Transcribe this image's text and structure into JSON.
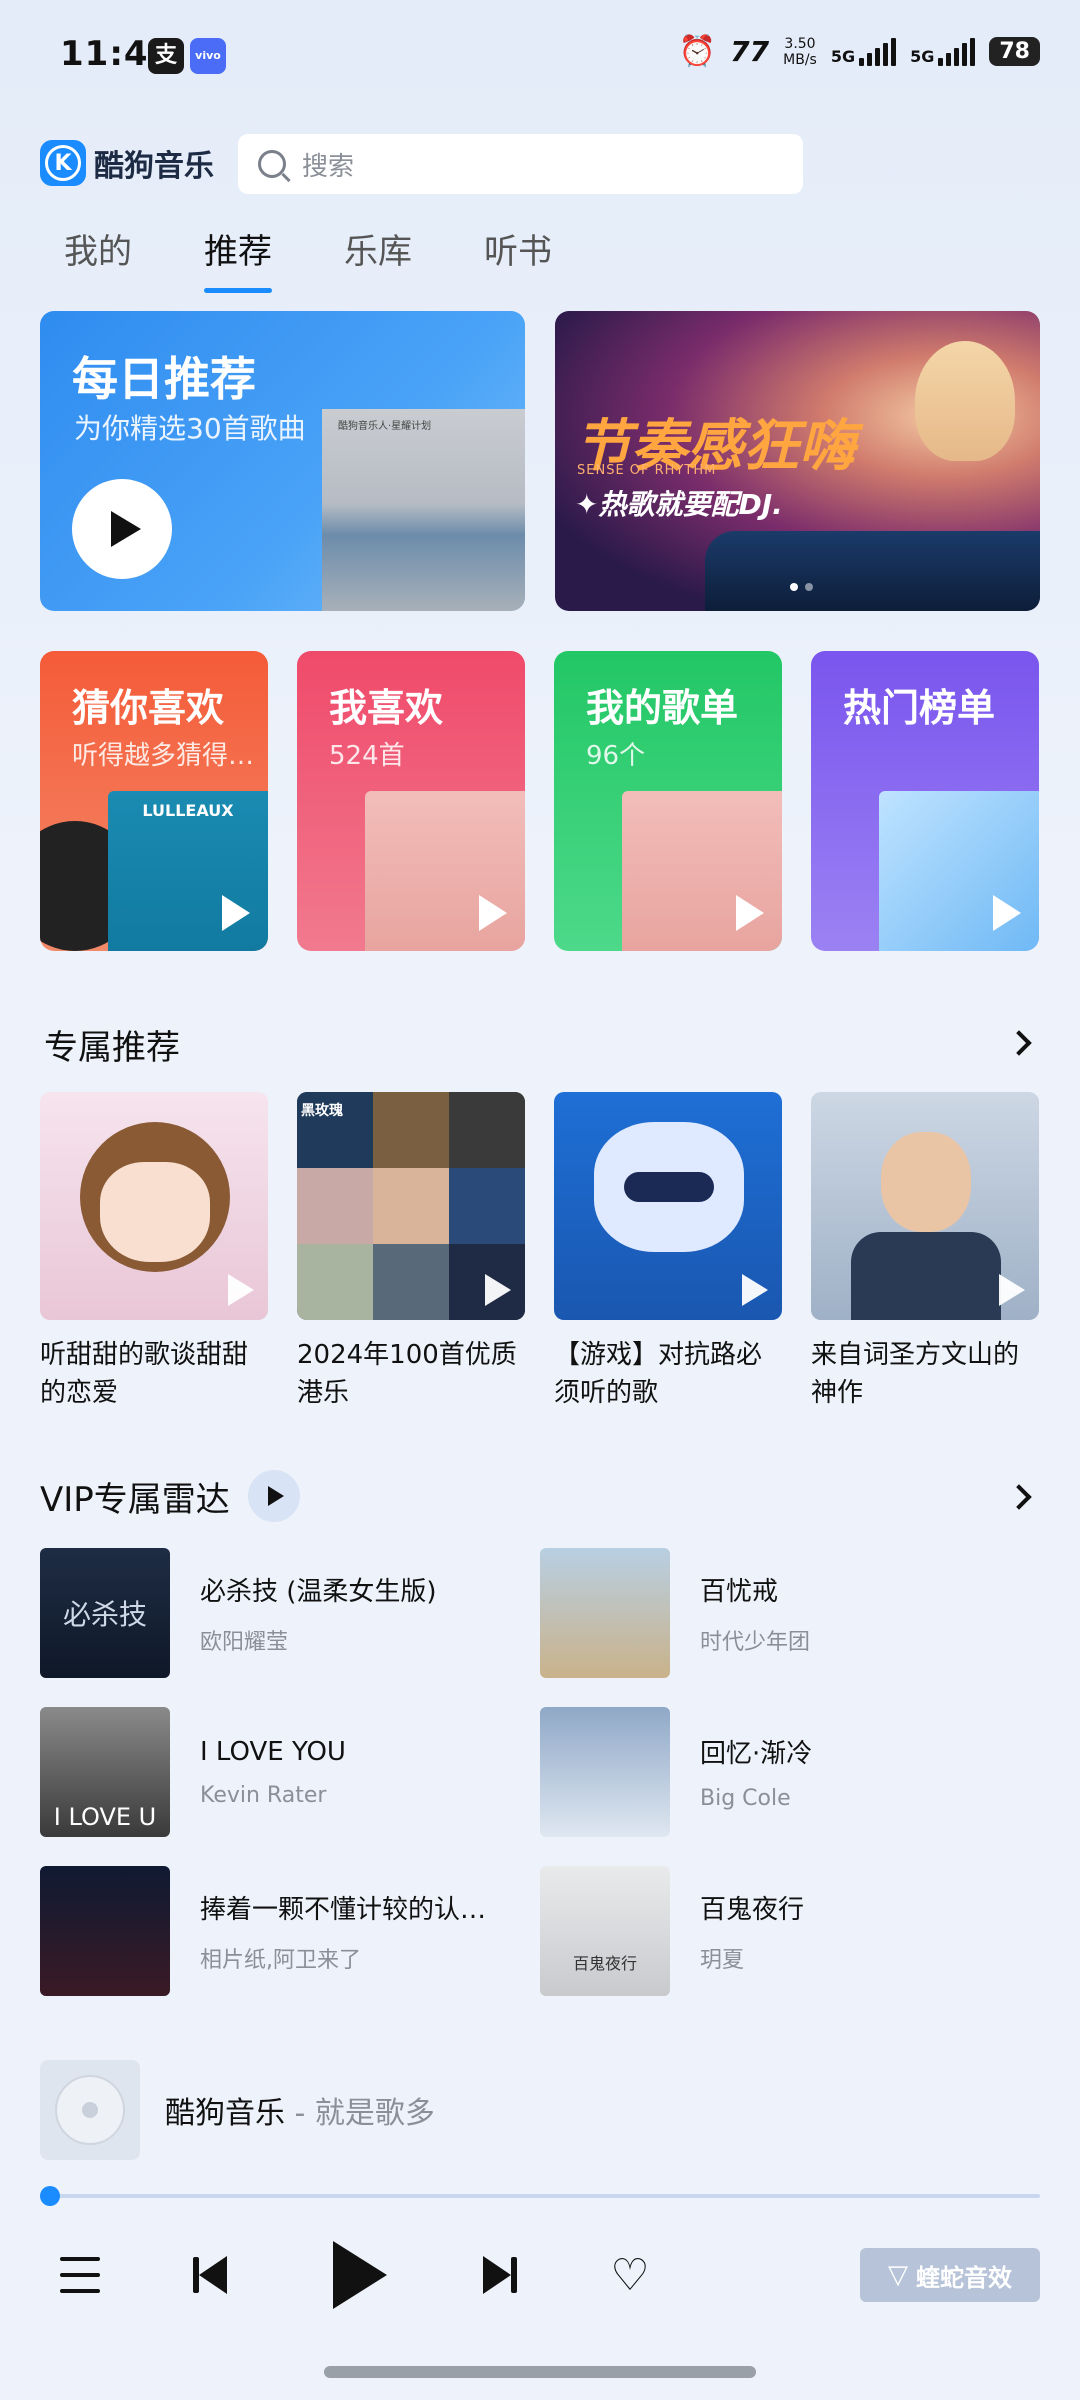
{
  "status_bar": {
    "time": "11:48",
    "app_icon_1": "支",
    "app_icon_2": "vivo",
    "speed_value": "3.50",
    "speed_unit": "MB/s",
    "sim1": "5G",
    "sim2": "5G",
    "battery": "78"
  },
  "header": {
    "logo_letter": "K",
    "app_name": "酷狗音乐",
    "search_placeholder": "搜索"
  },
  "tabs": [
    {
      "label": "我的"
    },
    {
      "label": "推荐"
    },
    {
      "label": "乐库"
    },
    {
      "label": "听书"
    }
  ],
  "active_tab": "推荐",
  "banners": {
    "daily": {
      "title": "每日推荐",
      "subtitle": "为你精选30首歌曲",
      "cover_caption": "酷狗音乐人·星耀计划"
    },
    "rhythm": {
      "title": "节奏感狂嗨",
      "en": "SENSE OF RHYTHM",
      "subtitle": "✦热歌就要配DJ."
    }
  },
  "quick_cards": [
    {
      "title": "猜你喜欢",
      "subtitle": "听得越多猜得…",
      "cover_text": "LULLEAUX",
      "color": "#f56a3c"
    },
    {
      "title": "我喜欢",
      "subtitle": "524首",
      "color": "#f04e6a"
    },
    {
      "title": "我的歌单",
      "subtitle": "96个",
      "color": "#2ccd6d"
    },
    {
      "title": "热门榜单",
      "subtitle": "",
      "color": "#7b5cf0"
    }
  ],
  "exclusive": {
    "title": "专属推荐",
    "playlists": [
      {
        "title": "听甜甜的歌谈甜甜的恋爱"
      },
      {
        "title": "2024年100首优质港乐",
        "cover_text": "黑玫瑰"
      },
      {
        "title": "【游戏】对抗路必须听的歌"
      },
      {
        "title": "来自词圣方文山的神作"
      }
    ]
  },
  "vip": {
    "title": "VIP专属雷达",
    "songs": [
      {
        "title": "必杀技 (温柔女生版)",
        "artist": "欧阳耀莹",
        "cover_text": "必杀技"
      },
      {
        "title": "百忧戒",
        "artist": "时代少年团"
      },
      {
        "title": "I LOVE YOU",
        "artist": "Kevin Rater",
        "cover_text": "I LOVE U"
      },
      {
        "title": "回忆·渐冷",
        "artist": "Big Cole"
      },
      {
        "title": "捧着一颗不懂计较的认…",
        "artist": "相片纸,阿卫来了"
      },
      {
        "title": "百鬼夜行",
        "artist": "玥夏",
        "cover_text": "百鬼夜行"
      }
    ]
  },
  "player": {
    "title": "酷狗音乐",
    "subtitle": " - 就是歌多",
    "progress": 0.0,
    "effect_label": "蝰蛇音效"
  }
}
